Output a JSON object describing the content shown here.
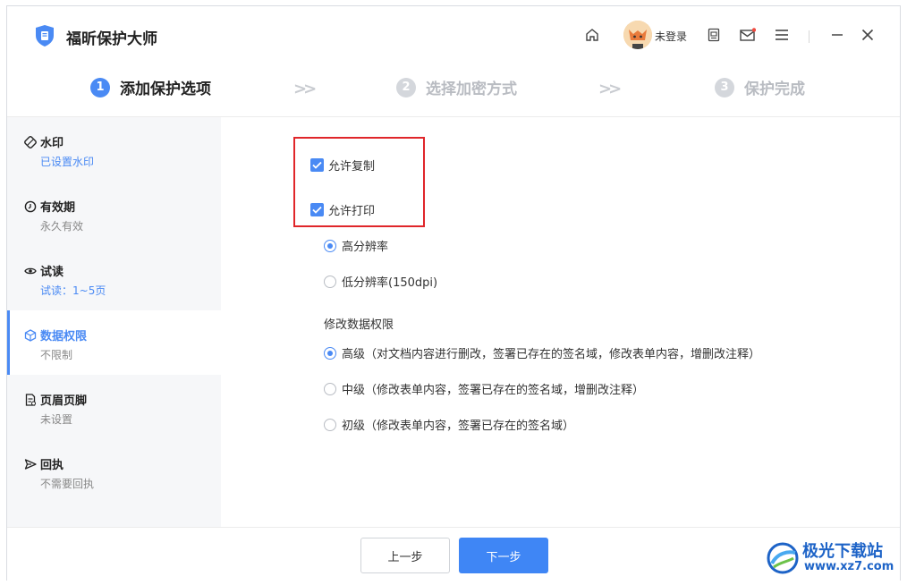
{
  "app": {
    "title": "福昕保护大师",
    "login_status": "未登录"
  },
  "titlebar_icons": [
    "home-icon",
    "avatar",
    "document-icon",
    "mail-icon",
    "menu-icon",
    "minimize-icon",
    "close-icon"
  ],
  "steps": [
    {
      "num": "1",
      "label": "添加保护选项",
      "state": "active"
    },
    {
      "num": "2",
      "label": "选择加密方式",
      "state": "inactive"
    },
    {
      "num": "3",
      "label": "保护完成",
      "state": "inactive"
    }
  ],
  "sidebar": {
    "items": [
      {
        "title": "水印",
        "subtitle": "已设置水印",
        "icon": "watermark-icon"
      },
      {
        "title": "有效期",
        "subtitle": "永久有效",
        "icon": "clock-icon"
      },
      {
        "title": "试读",
        "subtitle": "试读：1~5页",
        "icon": "eye-icon"
      },
      {
        "title": "数据权限",
        "subtitle": "不限制",
        "icon": "cube-icon"
      },
      {
        "title": "页眉页脚",
        "subtitle": "未设置",
        "icon": "header-footer-icon"
      },
      {
        "title": "回执",
        "subtitle": "不需要回执",
        "icon": "send-icon"
      }
    ],
    "active_index": 3
  },
  "permissions": {
    "allow_copy": "允许复制",
    "allow_print": "允许打印",
    "print_quality": {
      "high": "高分辨率",
      "low": "低分辨率(150dpi)",
      "selected": "high"
    },
    "modify_label": "修改数据权限",
    "modify_levels": {
      "high": "高级（对文档内容进行删改，签署已存在的签名域，修改表单内容，增删改注释）",
      "medium": "中级（修改表单内容，签署已存在的签名域，增删改注释）",
      "low": "初级（修改表单内容，签署已存在的签名域）",
      "selected": "high"
    }
  },
  "footer": {
    "prev": "上一步",
    "next": "下一步"
  },
  "watermark": {
    "title": "极光下载站",
    "url": "www.xz7.com"
  },
  "colors": {
    "accent": "#4a8af4",
    "highlight": "#e0262a",
    "sidebar_bg": "#f6f7f9"
  }
}
